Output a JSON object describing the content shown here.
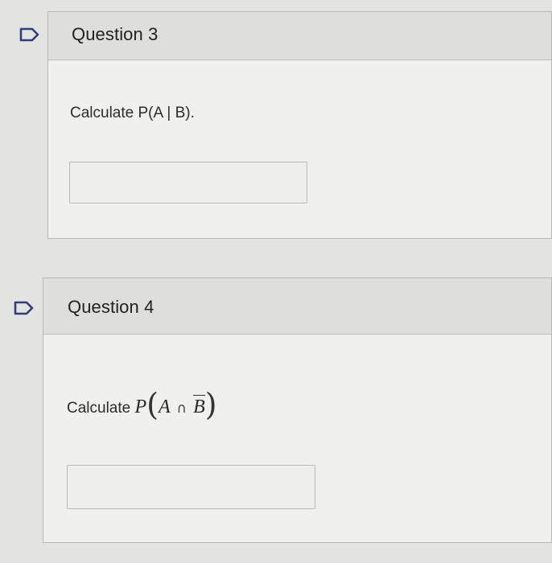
{
  "questions": [
    {
      "title": "Question 3",
      "prompt": "Calculate P(A | B).",
      "answer_value": "",
      "flag_icon": "flag-outline-icon"
    },
    {
      "title": "Question 4",
      "prompt_lead": "Calculate",
      "math": {
        "P": "P",
        "open": "(",
        "A": "A",
        "cap": "∩",
        "B": "B",
        "close": ")"
      },
      "answer_value": "",
      "flag_icon": "flag-outline-icon"
    }
  ],
  "colors": {
    "page_bg": "#e3e3e1",
    "card_bg": "#f0f0ef",
    "header_bg": "#dededc",
    "flag_stroke": "#2f3f7e"
  }
}
